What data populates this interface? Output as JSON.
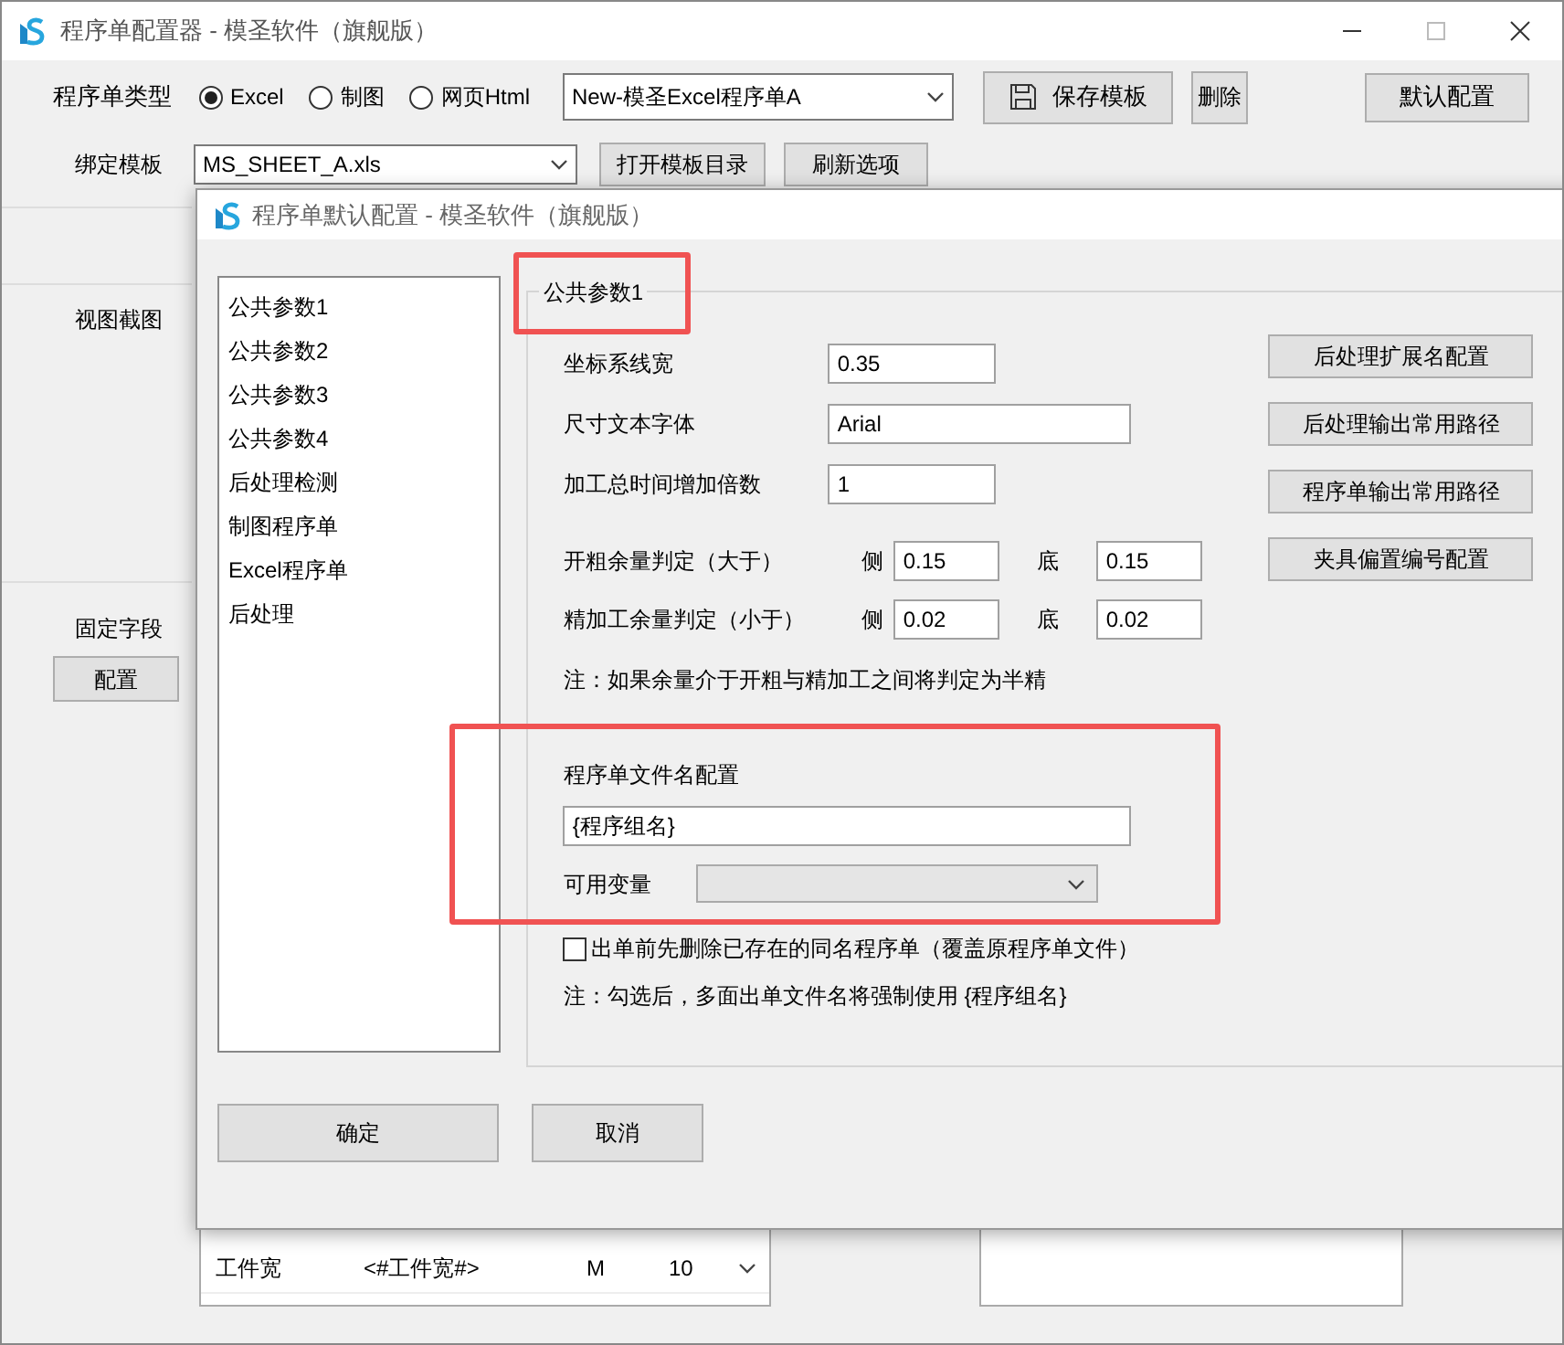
{
  "window": {
    "title": "程序单配置器 - 模圣软件（旗舰版）"
  },
  "type_row": {
    "label": "程序单类型",
    "radios": [
      {
        "label": "Excel",
        "selected": true
      },
      {
        "label": "制图",
        "selected": false
      },
      {
        "label": "网页Html",
        "selected": false
      }
    ],
    "template": "New-模圣Excel程序单A",
    "save": "保存模板",
    "delete": "删除",
    "default": "默认配置"
  },
  "bind_row": {
    "label": "绑定模板",
    "value": "MS_SHEET_A.xls",
    "buttons": [
      "打开模板目录",
      "刷新选项"
    ]
  },
  "side": {
    "view_label": "视图截图",
    "fixed_label": "固定字段",
    "config_button": "配置"
  },
  "table": {
    "rows": [
      {
        "cells": [
          "工件宽",
          "<#工件宽#>",
          "M",
          "10"
        ]
      }
    ]
  },
  "dialog": {
    "title": "程序单默认配置 - 模圣软件（旗舰版）",
    "nav": [
      {
        "label": "公共参数1"
      },
      {
        "label": "公共参数2"
      },
      {
        "label": "公共参数3"
      },
      {
        "label": "公共参数4"
      },
      {
        "label": "后处理检测"
      },
      {
        "label": "制图程序单"
      },
      {
        "label": "Excel程序单"
      },
      {
        "label": "后处理"
      }
    ],
    "group_title": "公共参数1",
    "fields": [
      {
        "label": "坐标系线宽",
        "value": "0.35",
        "kind": "short"
      },
      {
        "label": "尺寸文本字体",
        "value": "Arial",
        "kind": "long"
      },
      {
        "label": "加工总时间增加倍数",
        "value": "1",
        "kind": "short"
      }
    ],
    "margins": [
      {
        "label": "开粗余量判定（大于）",
        "side_label": "侧",
        "side_value": "0.15",
        "bottom_label": "底",
        "bottom_value": "0.15"
      },
      {
        "label": "精加工余量判定（小于）",
        "side_label": "侧",
        "side_value": "0.02",
        "bottom_label": "底",
        "bottom_value": "0.02"
      }
    ],
    "note": "注：如果余量介于开粗与精加工之间将判定为半精",
    "side_buttons": [
      "后处理扩展名配置",
      "后处理输出常用路径",
      "程序单输出常用路径",
      "夹具偏置编号配置"
    ],
    "filename": {
      "label": "程序单文件名配置",
      "value": "{程序组名}",
      "variable_label": "可用变量"
    },
    "checkbox": {
      "label": "出单前先删除已存在的同名程序单（覆盖原程序单文件）",
      "checked": false
    },
    "note2": "注：勾选后，多面出单文件名将强制使用 {程序组名}",
    "ok": "确定",
    "cancel": "取消"
  }
}
